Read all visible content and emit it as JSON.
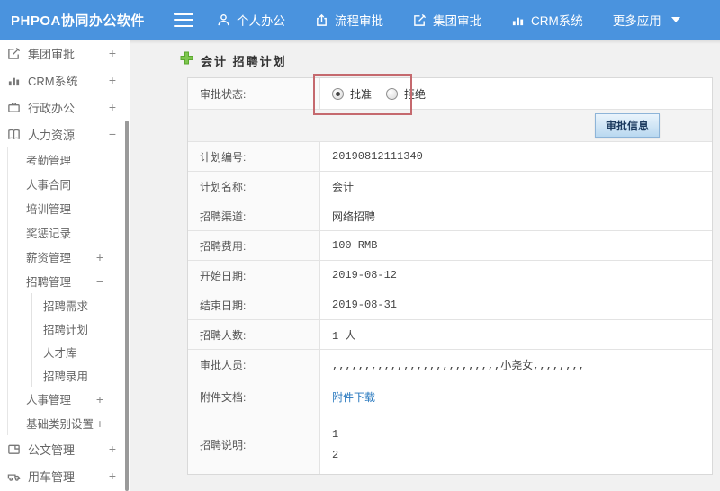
{
  "colors": {
    "topbar_blue": "#4a93de",
    "accent_green": "#7ec64f",
    "link_blue": "#2677be",
    "annotation_red": "#c5696e"
  },
  "topbar": {
    "brand": "PHPOA协同办公软件",
    "items": [
      {
        "label": "个人办公",
        "icon": "person-icon"
      },
      {
        "label": "流程审批",
        "icon": "process-icon"
      },
      {
        "label": "集团审批",
        "icon": "edit-icon"
      },
      {
        "label": "CRM系统",
        "icon": "chart-icon"
      },
      {
        "label": "更多应用",
        "icon": "caret-down-icon"
      }
    ]
  },
  "sidebar": {
    "items": [
      {
        "label": "集团审批",
        "icon": "edit-icon",
        "toggle": "+"
      },
      {
        "label": "CRM系统",
        "icon": "chart-icon",
        "toggle": "+"
      },
      {
        "label": "行政办公",
        "icon": "briefcase-icon",
        "toggle": "+"
      },
      {
        "label": "人力资源",
        "icon": "book-icon",
        "toggle": "−"
      },
      {
        "label": "考勤管理"
      },
      {
        "label": "人事合同"
      },
      {
        "label": "培训管理"
      },
      {
        "label": "奖惩记录"
      },
      {
        "label": "薪资管理",
        "toggle": "+"
      },
      {
        "label": "招聘管理",
        "toggle": "−"
      },
      {
        "label": "招聘需求"
      },
      {
        "label": "招聘计划"
      },
      {
        "label": "人才库"
      },
      {
        "label": "招聘录用"
      },
      {
        "label": "人事管理",
        "toggle": "+"
      },
      {
        "label": "基础类别设置",
        "toggle": "+"
      },
      {
        "label": "公文管理",
        "icon": "document-icon",
        "toggle": "+"
      },
      {
        "label": "用车管理",
        "icon": "car-icon",
        "toggle": "+"
      }
    ]
  },
  "main": {
    "title": "会计 招聘计划",
    "approval": {
      "label": "审批状态:",
      "options": [
        {
          "label": "批准",
          "checked": true
        },
        {
          "label": "拒绝",
          "checked": false
        }
      ],
      "button_label": "审批信息"
    },
    "table": {
      "rows": [
        {
          "label": "计划编号:",
          "value": "20190812111340"
        },
        {
          "label": "计划名称:",
          "value": "会计"
        },
        {
          "label": "招聘渠道:",
          "value": "网络招聘"
        },
        {
          "label": "招聘费用:",
          "value": "100 RMB"
        },
        {
          "label": "开始日期:",
          "value": "2019-08-12"
        },
        {
          "label": "结束日期:",
          "value": "2019-08-31"
        },
        {
          "label": "招聘人数:",
          "value": "1 人"
        },
        {
          "label": "审批人员:",
          "value": ",,,,,,,,,,,,,,,,,,,,,,,,,,小尧女,,,,,,,,"
        },
        {
          "label": "附件文档:",
          "value": "附件下载"
        },
        {
          "label": "招聘说明:",
          "lines": [
            "1",
            "2"
          ]
        }
      ]
    }
  }
}
